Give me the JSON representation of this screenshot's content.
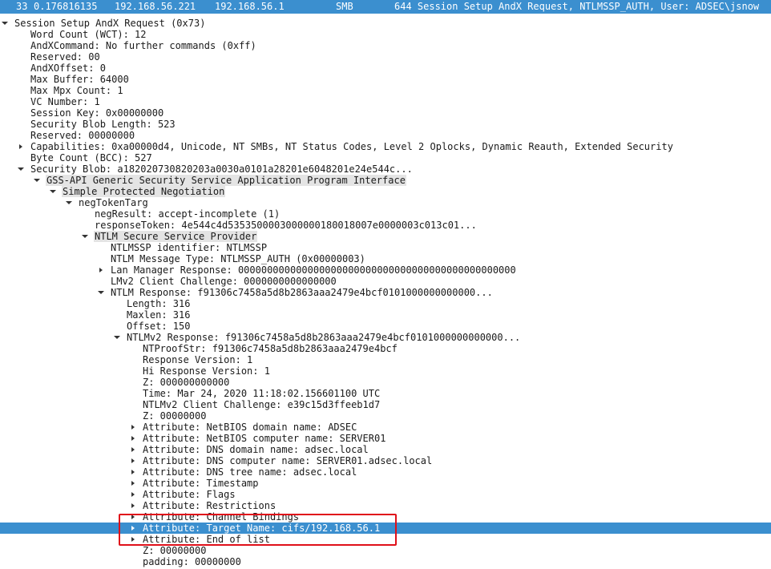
{
  "packet": {
    "number": "33",
    "time": "0.176816135",
    "source": "192.168.56.221",
    "destination": "192.168.56.1",
    "protocol": "SMB",
    "info": "644 Session Setup AndX Request, NTLMSSP_AUTH, User: ADSEC\\jsnow"
  },
  "tree": [
    {
      "text": "Session Setup AndX Request (0x73)",
      "level": 0,
      "toggle": "expanded"
    },
    {
      "text": "Word Count (WCT): 12",
      "level": 1,
      "toggle": "none"
    },
    {
      "text": "AndXCommand: No further commands (0xff)",
      "level": 1,
      "toggle": "none"
    },
    {
      "text": "Reserved: 00",
      "level": 1,
      "toggle": "none"
    },
    {
      "text": "AndXOffset: 0",
      "level": 1,
      "toggle": "none"
    },
    {
      "text": "Max Buffer: 64000",
      "level": 1,
      "toggle": "none"
    },
    {
      "text": "Max Mpx Count: 1",
      "level": 1,
      "toggle": "none"
    },
    {
      "text": "VC Number: 1",
      "level": 1,
      "toggle": "none"
    },
    {
      "text": "Session Key: 0x00000000",
      "level": 1,
      "toggle": "none"
    },
    {
      "text": "Security Blob Length: 523",
      "level": 1,
      "toggle": "none"
    },
    {
      "text": "Reserved: 00000000",
      "level": 1,
      "toggle": "none"
    },
    {
      "text": "Capabilities: 0xa00000d4, Unicode, NT SMBs, NT Status Codes, Level 2 Oplocks, Dynamic Reauth, Extended Security",
      "level": 1,
      "toggle": "collapsed"
    },
    {
      "text": "Byte Count (BCC): 527",
      "level": 1,
      "toggle": "none"
    },
    {
      "text": "Security Blob: a182020730820203a0030a0101a28201e6048201e24e544c...",
      "level": 1,
      "toggle": "expanded"
    },
    {
      "text": "GSS-API Generic Security Service Application Program Interface",
      "level": 2,
      "toggle": "expanded",
      "highlight": "grey"
    },
    {
      "text": "Simple Protected Negotiation",
      "level": 3,
      "toggle": "expanded",
      "highlight": "grey"
    },
    {
      "text": "negTokenTarg",
      "level": 4,
      "toggle": "expanded"
    },
    {
      "text": "negResult: accept-incomplete (1)",
      "level": 5,
      "toggle": "none"
    },
    {
      "text": "responseToken: 4e544c4d5353500003000000180018007e0000003c013c01...",
      "level": 5,
      "toggle": "none"
    },
    {
      "text": "NTLM Secure Service Provider",
      "level": 5,
      "toggle": "expanded",
      "highlight": "grey"
    },
    {
      "text": "NTLMSSP identifier: NTLMSSP",
      "level": 6,
      "toggle": "none"
    },
    {
      "text": "NTLM Message Type: NTLMSSP_AUTH (0x00000003)",
      "level": 6,
      "toggle": "none"
    },
    {
      "text": "Lan Manager Response: 000000000000000000000000000000000000000000000000",
      "level": 6,
      "toggle": "collapsed"
    },
    {
      "text": "LMv2 Client Challenge: 0000000000000000",
      "level": 6,
      "toggle": "none"
    },
    {
      "text": "NTLM Response: f91306c7458a5d8b2863aaa2479e4bcf0101000000000000...",
      "level": 6,
      "toggle": "expanded"
    },
    {
      "text": "Length: 316",
      "level": 7,
      "toggle": "none"
    },
    {
      "text": "Maxlen: 316",
      "level": 7,
      "toggle": "none"
    },
    {
      "text": "Offset: 150",
      "level": 7,
      "toggle": "none"
    },
    {
      "text": "NTLMv2 Response: f91306c7458a5d8b2863aaa2479e4bcf0101000000000000...",
      "level": 7,
      "toggle": "expanded"
    },
    {
      "text": "NTProofStr: f91306c7458a5d8b2863aaa2479e4bcf",
      "level": 8,
      "toggle": "none"
    },
    {
      "text": "Response Version: 1",
      "level": 8,
      "toggle": "none"
    },
    {
      "text": "Hi Response Version: 1",
      "level": 8,
      "toggle": "none"
    },
    {
      "text": "Z: 000000000000",
      "level": 8,
      "toggle": "none"
    },
    {
      "text": "Time: Mar 24, 2020 11:18:02.156601100 UTC",
      "level": 8,
      "toggle": "none"
    },
    {
      "text": "NTLMv2 Client Challenge: e39c15d3ffeeb1d7",
      "level": 8,
      "toggle": "none"
    },
    {
      "text": "Z: 00000000",
      "level": 8,
      "toggle": "none"
    },
    {
      "text": "Attribute: NetBIOS domain name: ADSEC",
      "level": 8,
      "toggle": "collapsed"
    },
    {
      "text": "Attribute: NetBIOS computer name: SERVER01",
      "level": 8,
      "toggle": "collapsed"
    },
    {
      "text": "Attribute: DNS domain name: adsec.local",
      "level": 8,
      "toggle": "collapsed"
    },
    {
      "text": "Attribute: DNS computer name: SERVER01.adsec.local",
      "level": 8,
      "toggle": "collapsed"
    },
    {
      "text": "Attribute: DNS tree name: adsec.local",
      "level": 8,
      "toggle": "collapsed"
    },
    {
      "text": "Attribute: Timestamp",
      "level": 8,
      "toggle": "collapsed"
    },
    {
      "text": "Attribute: Flags",
      "level": 8,
      "toggle": "collapsed"
    },
    {
      "text": "Attribute: Restrictions",
      "level": 8,
      "toggle": "collapsed"
    },
    {
      "text": "Attribute: Channel Bindings",
      "level": 8,
      "toggle": "collapsed"
    },
    {
      "text": "Attribute: Target Name: cifs/192.168.56.1",
      "level": 8,
      "toggle": "collapsed",
      "selected": true
    },
    {
      "text": "Attribute: End of list",
      "level": 8,
      "toggle": "collapsed"
    },
    {
      "text": "Z: 00000000",
      "level": 8,
      "toggle": "none"
    },
    {
      "text": "padding: 00000000",
      "level": 8,
      "toggle": "none"
    }
  ],
  "colors": {
    "selection": "#3b8fcf",
    "highlight_box": "#e0101a",
    "group_highlight": "#e4e4e4"
  }
}
